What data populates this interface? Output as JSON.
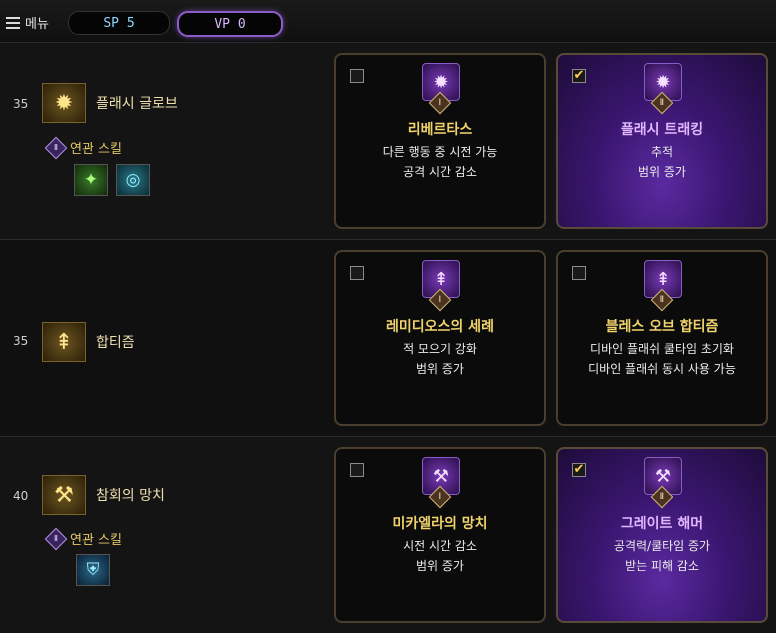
{
  "topbar": {
    "menu_label": "메뉴",
    "sp_label": "SP 5",
    "vp_label": "VP 0"
  },
  "rows": [
    {
      "level": "35",
      "skill_name": "플래시 글로브",
      "related_label": "연관 스킬",
      "related_badge": "Ⅱ",
      "cards": [
        {
          "badge": "Ⅰ",
          "title": "리베르타스",
          "desc1": "다른 행동 중 시전 가능",
          "desc2": "공격 시간 감소",
          "checked": false
        },
        {
          "badge": "Ⅱ",
          "title": "플래시 트래킹",
          "desc1": "추적",
          "desc2": "범위 증가",
          "checked": true
        }
      ]
    },
    {
      "level": "35",
      "skill_name": "합티즘",
      "cards": [
        {
          "badge": "Ⅰ",
          "title": "레미디오스의 세례",
          "desc1": "적 모으기 강화",
          "desc2": "범위 증가",
          "checked": false
        },
        {
          "badge": "Ⅱ",
          "title": "블레스 오브 합티즘",
          "desc1": "디바인 플래쉬 쿨타임 초기화",
          "desc2": "디바인 플래쉬 동시 사용 가능",
          "checked": false
        }
      ]
    },
    {
      "level": "40",
      "skill_name": "참회의 망치",
      "related_label": "연관 스킬",
      "related_badge": "Ⅱ",
      "cards": [
        {
          "badge": "Ⅰ",
          "title": "미카엘라의 망치",
          "desc1": "시전 시간 감소",
          "desc2": "범위 증가",
          "checked": false
        },
        {
          "badge": "Ⅱ",
          "title": "그레이트 해머",
          "desc1": "공격력/쿨타임 증가",
          "desc2": "받는 피해 감소",
          "checked": true
        }
      ]
    }
  ],
  "check_mark": "✔"
}
